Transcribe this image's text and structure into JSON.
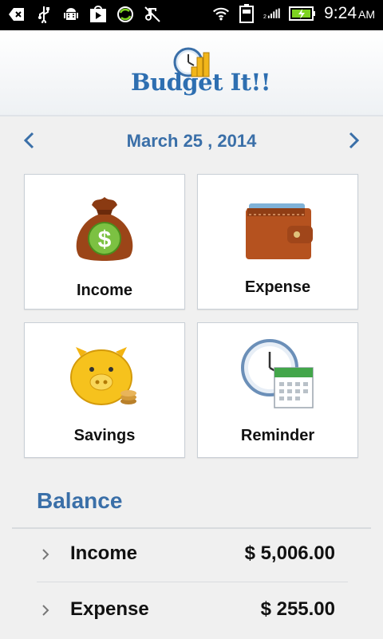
{
  "status_bar": {
    "icons": [
      "back-icon",
      "usb-icon",
      "android-debug-icon",
      "play-store-icon",
      "sync-icon",
      "music-off-icon",
      "wifi-icon",
      "battery-saver-icon",
      "signal-icon",
      "battery-charging-icon"
    ],
    "time": "9:24",
    "ampm": "AM"
  },
  "header": {
    "logo_text": "Budget It!!"
  },
  "date_nav": {
    "date": "March 25 , 2014"
  },
  "tiles": {
    "income": {
      "label": "Income"
    },
    "expense": {
      "label": "Expense"
    },
    "savings": {
      "label": "Savings"
    },
    "reminder": {
      "label": "Reminder"
    }
  },
  "balance": {
    "title": "Balance",
    "rows": [
      {
        "label": "Income",
        "amount": "$ 5,006.00"
      },
      {
        "label": "Expense",
        "amount": "$ 255.00"
      }
    ]
  },
  "colors": {
    "accent": "#3a6fa8",
    "status_bar": "#000000",
    "battery_green": "#7ed321"
  }
}
